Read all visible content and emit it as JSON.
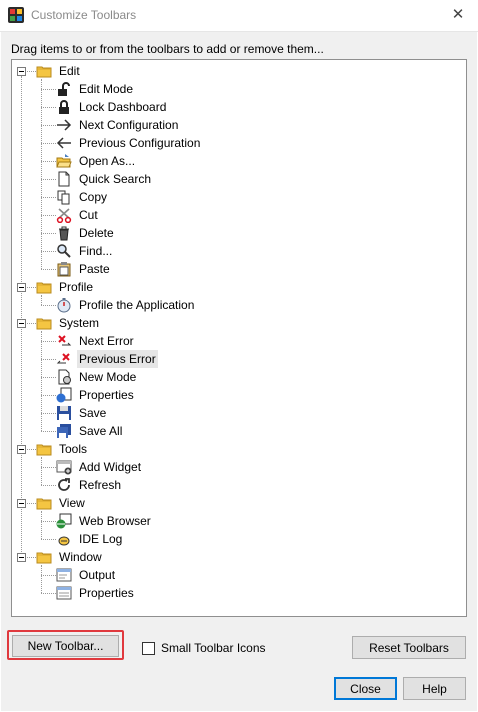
{
  "window": {
    "title": "Customize Toolbars",
    "close_glyph": "✕"
  },
  "instruction": "Drag items to or from the toolbars to add or remove them...",
  "tree": [
    {
      "label": "Edit",
      "icon": "folder-icon",
      "children": [
        {
          "label": "Edit Mode",
          "icon": "unlock-icon"
        },
        {
          "label": "Lock Dashboard",
          "icon": "lock-icon"
        },
        {
          "label": "Next Configuration",
          "icon": "arrow-right-icon"
        },
        {
          "label": "Previous Configuration",
          "icon": "arrow-left-icon"
        },
        {
          "label": "Open As...",
          "icon": "open-folder-icon"
        },
        {
          "label": "Quick Search",
          "icon": "document-icon"
        },
        {
          "label": "Copy",
          "icon": "copy-icon"
        },
        {
          "label": "Cut",
          "icon": "scissors-icon"
        },
        {
          "label": "Delete",
          "icon": "trash-icon"
        },
        {
          "label": "Find...",
          "icon": "magnifier-icon"
        },
        {
          "label": "Paste",
          "icon": "clipboard-icon"
        }
      ]
    },
    {
      "label": "Profile",
      "icon": "folder-icon",
      "children": [
        {
          "label": "Profile the Application",
          "icon": "stopwatch-icon"
        }
      ]
    },
    {
      "label": "System",
      "icon": "folder-icon",
      "children": [
        {
          "label": "Next Error",
          "icon": "next-error-icon"
        },
        {
          "label": "Previous Error",
          "icon": "previous-error-icon",
          "selected": true
        },
        {
          "label": "New Mode",
          "icon": "new-mode-icon"
        },
        {
          "label": "Properties",
          "icon": "properties-icon"
        },
        {
          "label": "Save",
          "icon": "floppy-icon"
        },
        {
          "label": "Save All",
          "icon": "save-all-icon"
        }
      ]
    },
    {
      "label": "Tools",
      "icon": "folder-icon",
      "children": [
        {
          "label": "Add Widget",
          "icon": "add-widget-icon"
        },
        {
          "label": "Refresh",
          "icon": "refresh-icon"
        }
      ]
    },
    {
      "label": "View",
      "icon": "folder-icon",
      "children": [
        {
          "label": "Web Browser",
          "icon": "web-browser-icon"
        },
        {
          "label": "IDE Log",
          "icon": "ide-log-icon"
        }
      ]
    },
    {
      "label": "Window",
      "icon": "folder-icon",
      "children": [
        {
          "label": "Output",
          "icon": "output-window-icon"
        },
        {
          "label": "Properties",
          "icon": "properties-window-icon"
        }
      ]
    }
  ],
  "buttons": {
    "new_toolbar": "New Toolbar...",
    "reset_toolbars": "Reset Toolbars",
    "close": "Close",
    "help": "Help"
  },
  "small_icons_checkbox": {
    "label": "Small Toolbar Icons",
    "checked": false
  },
  "colors": {
    "accent": "#0078d7",
    "highlight": "#e0393e",
    "folder": "#f4c542"
  }
}
